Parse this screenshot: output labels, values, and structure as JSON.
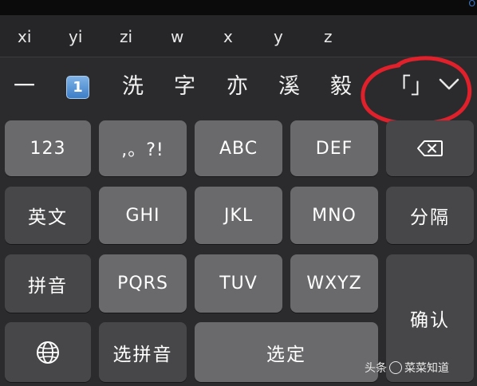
{
  "status_edge_text": "O",
  "pinyin_options": [
    "xi",
    "yi",
    "zi",
    "w",
    "x",
    "y",
    "z"
  ],
  "candidates": {
    "dash": "一",
    "badge": "1",
    "words": [
      "洗",
      "字",
      "亦",
      "溪",
      "毅"
    ],
    "bracket": "「」"
  },
  "keys": {
    "row1": [
      "123",
      ",。?!",
      "ABC",
      "DEF"
    ],
    "row2": [
      "英文",
      "GHI",
      "JKL",
      "MNO",
      "分隔"
    ],
    "row3": [
      "拼音",
      "PQRS",
      "TUV",
      "WXYZ"
    ],
    "confirm": "确认",
    "select_pinyin": "选拼音",
    "space": "选定"
  },
  "icons": {
    "delete": "delete-backspace-icon",
    "globe": "globe-icon",
    "expand": "chevron-down-icon"
  },
  "colors": {
    "annotation": "#e0202a",
    "light_key": "#6a6a6d",
    "dark_key": "#474749",
    "background": "#2b2b2d"
  },
  "watermark": {
    "text_left": "头条",
    "text_right": "菜菜知道"
  }
}
